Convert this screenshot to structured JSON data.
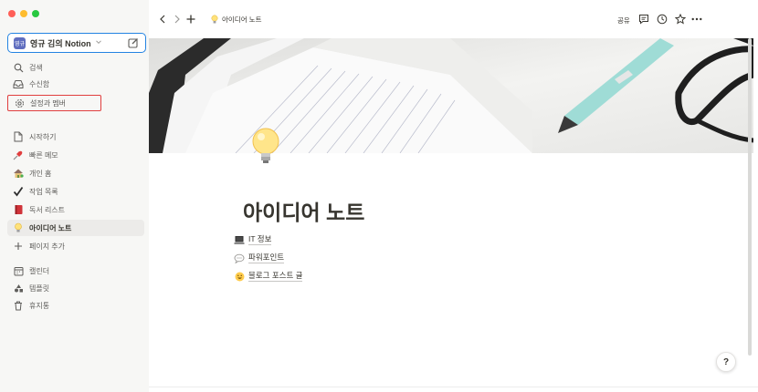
{
  "sidebar": {
    "workspace_name": "영규 김의 Notion",
    "workspace_avatar_text": "영규",
    "items": [
      {
        "label": "검색",
        "icon": "search-icon"
      },
      {
        "label": "수신함",
        "icon": "inbox-icon"
      },
      {
        "label": "설정과 멤버",
        "icon": "gear-icon"
      },
      {
        "label": "시작하기",
        "icon": "page-icon"
      },
      {
        "label": "빠른 메모",
        "icon": "pushpin-icon"
      },
      {
        "label": "개인 홈",
        "icon": "house-icon"
      },
      {
        "label": "작업 목록",
        "icon": "checkmark-icon"
      },
      {
        "label": "독서 리스트",
        "icon": "book-icon"
      },
      {
        "label": "아이디어 노트",
        "icon": "lightbulb-icon"
      },
      {
        "label": "페이지 추가",
        "icon": "plus-icon"
      },
      {
        "label": "캘린더",
        "icon": "calendar-icon"
      },
      {
        "label": "템플릿",
        "icon": "shapes-icon"
      },
      {
        "label": "휴지통",
        "icon": "trash-icon"
      }
    ]
  },
  "topbar": {
    "breadcrumb": "아이디어 노트",
    "share_label": "공유"
  },
  "page": {
    "title": "아이디어 노트",
    "items": [
      {
        "label": "IT 정보",
        "icon": "laptop-icon"
      },
      {
        "label": "파워포인트",
        "icon": "speech-bubble-icon"
      },
      {
        "label": "블로그 포스트 글",
        "icon": "smiley-icon"
      }
    ]
  },
  "help_label": "?",
  "colors": {
    "sidebar_bg": "#f7f7f5",
    "accent_blue": "#2383e2",
    "highlight_red": "#e03e3e",
    "text": "#37352f"
  }
}
